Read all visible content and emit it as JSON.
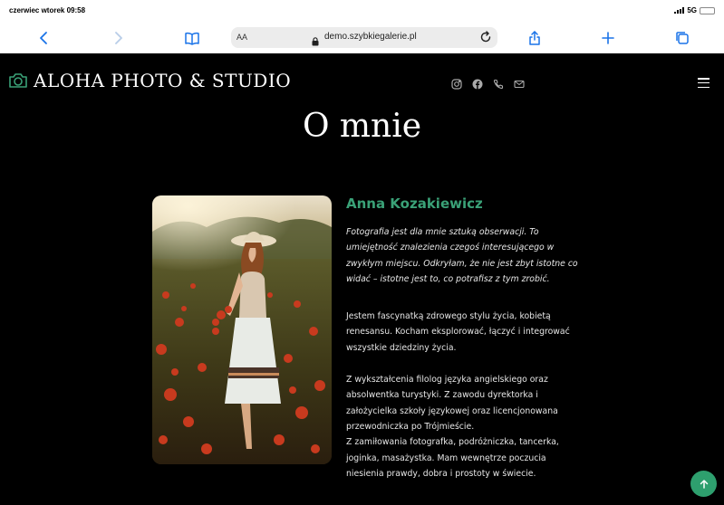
{
  "status": {
    "time": "czerwiec wtorek 09:58",
    "network": "5G"
  },
  "browser": {
    "text_size_label": "AA",
    "url": "demo.szybkiegalerie.pl",
    "icons": [
      "chevron-left-icon",
      "chevron-right-icon",
      "book-icon",
      "lock-icon",
      "reload-icon",
      "share-icon",
      "plus-icon",
      "tabs-icon"
    ]
  },
  "site": {
    "brand": "ALOHA PHOTO & STUDIO",
    "brand_icon": "camera-icon",
    "accent_color": "#3aa177",
    "social": [
      "instagram-icon",
      "facebook-icon",
      "phone-icon",
      "mail-icon"
    ],
    "page_title": "O mnie",
    "person_name": "Anna Kozakiewicz",
    "quote": "Fotografia jest dla mnie sztuką obserwacji. To umiejętność znalezienia czegoś interesującego w zwykłym miejscu. Odkryłam, że nie jest zbyt istotne co widać – istotne jest to, co potrafisz z tym zrobić.",
    "paragraph1": "Jestem fascynatką zdrowego stylu życia, kobietą renesansu. Kocham eksplorować, łączyć i integrować wszystkie dziedziny życia.",
    "paragraph2_line1": "Z wykształcenia filolog języka angielskiego oraz absolwentka turystyki. Z zawodu dyrektorka i założycielka szkoły językowej oraz licencjonowana przewodniczka po Trójmieście.",
    "paragraph2_line2": "Z zamiłowania fotografka, podróżniczka, tancerka, joginka, masażystka. Mam wewnętrze poczucia niesienia prawdy, dobra i prostoty w świecie.",
    "photo_alt": "woman in hat in poppy field"
  }
}
